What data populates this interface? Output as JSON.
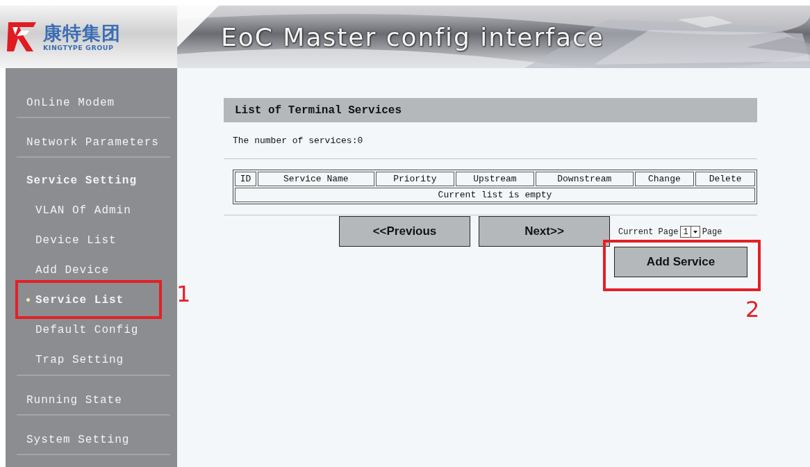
{
  "logo": {
    "name": "康特集团",
    "subtitle": "KINGTYPE GROUP"
  },
  "banner": {
    "title": "EoC Master config interface"
  },
  "sidebar": {
    "items": [
      {
        "label": "OnLine Modem",
        "expanded": false
      },
      {
        "label": "Network Parameters",
        "expanded": false
      },
      {
        "label": "Service Setting",
        "expanded": true,
        "children": [
          {
            "label": "VLAN Of Admin",
            "selected": false
          },
          {
            "label": "Device List",
            "selected": false
          },
          {
            "label": "Add Device",
            "selected": false
          },
          {
            "label": "Service List",
            "selected": true
          },
          {
            "label": "Default Config",
            "selected": false
          },
          {
            "label": "Trap Setting",
            "selected": false
          }
        ]
      },
      {
        "label": "Running State",
        "expanded": false
      },
      {
        "label": "System Setting",
        "expanded": false
      }
    ]
  },
  "panel": {
    "title": "List of Terminal Services",
    "count_text": "The number of services:0",
    "table": {
      "columns": [
        "ID",
        "Service Name",
        "Priority",
        "Upstream",
        "Downstream",
        "Change",
        "Delete"
      ],
      "empty_text": "Current list is empty"
    },
    "buttons": [
      "<<Previous",
      "Next>>"
    ],
    "pagination": {
      "label_before": "Current Page",
      "page": "1",
      "label_after": "Page"
    },
    "add_button": "Add Service"
  },
  "annotations": [
    {
      "label": "1"
    },
    {
      "label": "2"
    }
  ]
}
